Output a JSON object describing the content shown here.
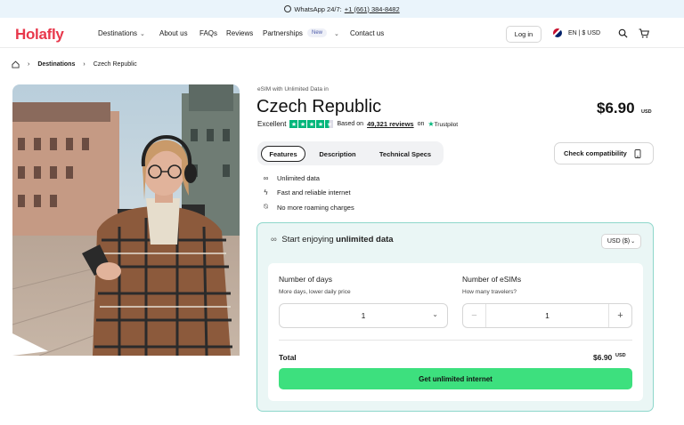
{
  "topbar": {
    "text": "WhatsApp 24/7:",
    "phone": "+1 (661) 384-8482"
  },
  "nav": {
    "logo": "Holafly",
    "items": [
      "Destinations",
      "About us",
      "FAQs",
      "Reviews",
      "Partnerships",
      "Contact us"
    ],
    "new_badge": "New",
    "login": "Log in",
    "lang": "EN | $ USD"
  },
  "breadcrumb": {
    "current_section": "Destinations",
    "current_page": "Czech Republic"
  },
  "product": {
    "subtitle": "eSIM with Unlimited Data in",
    "title": "Czech Republic",
    "price": "$6.90",
    "price_currency": "USD",
    "rating_label": "Excellent",
    "based_on": "Based on",
    "reviews": "49,321 reviews",
    "on": "on",
    "trustpilot": "Trustpilot"
  },
  "tabs": [
    "Features",
    "Description",
    "Technical Specs"
  ],
  "compat_label": "Check compatibility",
  "features": [
    "Unlimited data",
    "Fast and reliable internet",
    "No more roaming charges"
  ],
  "panel": {
    "head_prefix": "Start enjoying",
    "head_bold": "unlimited data",
    "currency": "USD ($)",
    "days_label": "Number of days",
    "days_hint": "More days, lower daily price",
    "days_value": "1",
    "esims_label": "Number of eSIMs",
    "esims_hint": "How many travelers?",
    "esims_value": "1",
    "total_label": "Total",
    "total_value": "$6.90",
    "total_currency": "USD",
    "cta": "Get unlimited internet"
  },
  "colors": {
    "brand": "#e8374b",
    "accent_green": "#3de07e",
    "panel_bg": "#eaf6f5",
    "panel_border": "#8ed7cb",
    "trustpilot": "#00b67a"
  }
}
